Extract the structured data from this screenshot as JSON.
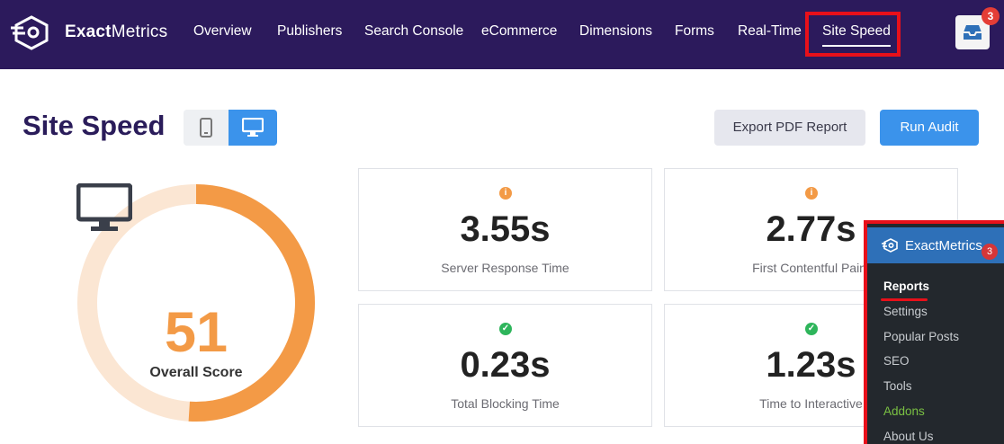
{
  "brand": {
    "name_bold": "Exact",
    "name_regular": "Metrics",
    "logo_icon": "exactmetrics-logo-icon"
  },
  "nav": {
    "items": [
      {
        "label": "Overview"
      },
      {
        "label": "Publishers"
      },
      {
        "label": "Search Console"
      },
      {
        "label": "eCommerce"
      },
      {
        "label": "Dimensions"
      },
      {
        "label": "Forms"
      },
      {
        "label": "Real-Time"
      },
      {
        "label": "Site Speed",
        "active": true
      }
    ],
    "notifications_icon": "inbox-icon",
    "notifications_count": "3"
  },
  "page": {
    "title": "Site Speed",
    "device_toggle": {
      "mobile_icon": "mobile-icon",
      "desktop_icon": "desktop-icon",
      "selected": "desktop"
    },
    "export_label": "Export PDF Report",
    "run_label": "Run Audit"
  },
  "score": {
    "value": "51",
    "label": "Overall Score",
    "fraction": 0.51,
    "icon": "monitor-icon",
    "colors": {
      "track": "#fbe6d3",
      "fill": "#f39a46"
    }
  },
  "metrics": [
    {
      "value": "3.55s",
      "label": "Server Response Time",
      "status": "info",
      "status_icon": "info-icon"
    },
    {
      "value": "2.77s",
      "label": "First Contentful Paint",
      "status": "info",
      "status_icon": "info-icon"
    },
    {
      "value": "0.23s",
      "label": "Total Blocking Time",
      "status": "ok",
      "status_icon": "check-icon"
    },
    {
      "value": "1.23s",
      "label": "Time to Interactive",
      "status": "ok",
      "status_icon": "check-icon"
    }
  ],
  "wp_menu": {
    "title": "ExactMetrics",
    "badge": "3",
    "items": [
      {
        "label": "Reports",
        "current": true
      },
      {
        "label": "Settings"
      },
      {
        "label": "Popular Posts"
      },
      {
        "label": "SEO"
      },
      {
        "label": "Tools"
      },
      {
        "label": "Addons",
        "highlight": true
      },
      {
        "label": "About Us"
      }
    ]
  },
  "colors": {
    "topbar": "#2c1a5c",
    "accent_blue": "#3b93eb",
    "annotation_red": "#e8101a",
    "status_orange": "#f39a46",
    "status_green": "#2eb55b"
  }
}
